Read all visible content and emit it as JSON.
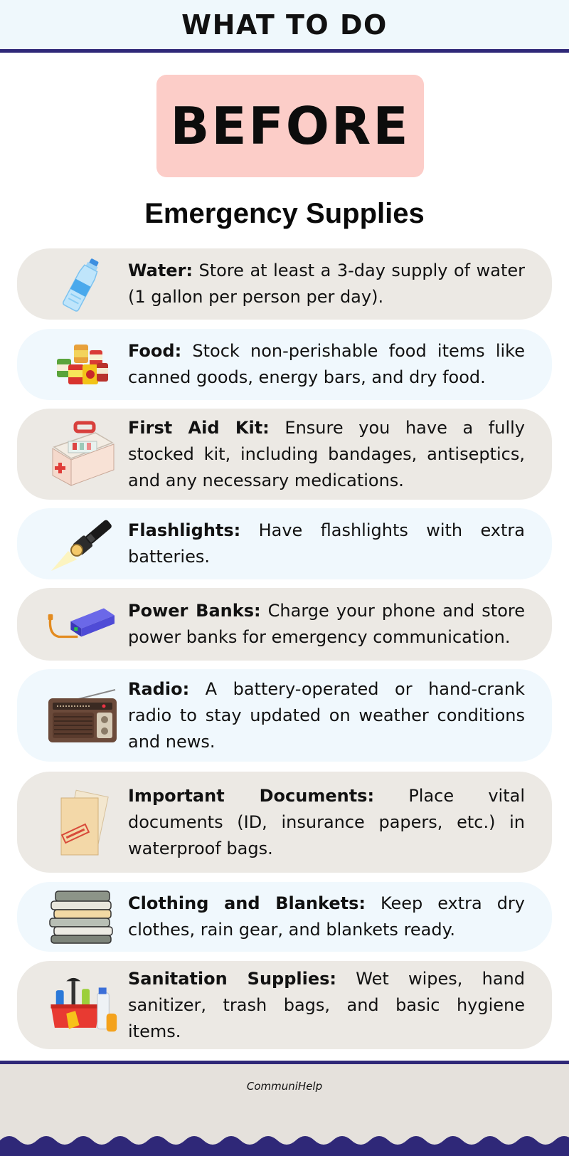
{
  "header": {
    "title": "WHAT TO DO"
  },
  "phase": {
    "label": "BEFORE"
  },
  "section": {
    "title": "Emergency Supplies"
  },
  "colors": {
    "navy": "#2f2878",
    "pink": "#fccdc8",
    "tan": "#ece9e4",
    "light_blue": "#f0f8fd"
  },
  "items": [
    {
      "title": "Water:",
      "body": "Store at least a 3-day supply of water (1 gallon per person per day).",
      "icon": "water-bottle-icon"
    },
    {
      "title": "Food:",
      "body": "Stock non-perishable food items like canned goods, energy bars, and dry food.",
      "icon": "canned-food-icon"
    },
    {
      "title": "First Aid Kit:",
      "body": "Ensure you have a fully stocked kit, including bandages, antiseptics, and any necessary medications.",
      "icon": "first-aid-kit-icon"
    },
    {
      "title": "Flashlights:",
      "body": "Have flashlights with extra batteries.",
      "icon": "flashlight-icon"
    },
    {
      "title": "Power Banks:",
      "body": "Charge your phone and store power banks for emergency communication.",
      "icon": "power-bank-icon"
    },
    {
      "title": "Radio:",
      "body": "A battery-operated or hand-crank radio to stay updated on weather conditions and news.",
      "icon": "radio-icon"
    },
    {
      "title": "Important Documents:",
      "body": "Place vital documents (ID, insurance papers, etc.) in waterproof bags.",
      "icon": "documents-folder-icon"
    },
    {
      "title": "Clothing and Blankets:",
      "body": "Keep extra dry clothes, rain gear, and blankets ready.",
      "icon": "folded-clothes-icon"
    },
    {
      "title": "Sanitation Supplies:",
      "body": "Wet wipes, hand sanitizer, trash bags, and basic hygiene items.",
      "icon": "cleaning-supplies-icon"
    }
  ],
  "footer": {
    "brand": "CommuniHelp"
  }
}
